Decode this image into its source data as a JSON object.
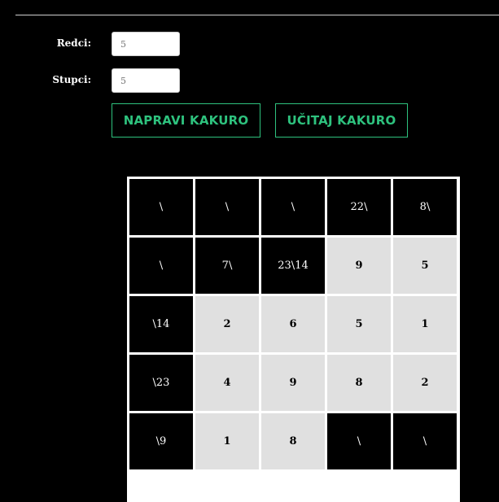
{
  "form": {
    "rows_label": "Redci:",
    "rows_value": "5",
    "cols_label": "Stupci:",
    "cols_value": "5"
  },
  "buttons": {
    "create": "NAPRAVI KAKURO",
    "load": "UČITAJ KAKURO"
  },
  "grid": {
    "rows": [
      [
        {
          "type": "black",
          "text": "\\"
        },
        {
          "type": "black",
          "text": "\\"
        },
        {
          "type": "black",
          "text": "\\"
        },
        {
          "type": "black",
          "text": "22\\"
        },
        {
          "type": "black",
          "text": "8\\"
        }
      ],
      [
        {
          "type": "black",
          "text": "\\"
        },
        {
          "type": "black",
          "text": "7\\"
        },
        {
          "type": "black",
          "text": "23\\14"
        },
        {
          "type": "white",
          "text": "9"
        },
        {
          "type": "white",
          "text": "5"
        }
      ],
      [
        {
          "type": "black",
          "text": "\\14"
        },
        {
          "type": "white",
          "text": "2"
        },
        {
          "type": "white",
          "text": "6"
        },
        {
          "type": "white",
          "text": "5"
        },
        {
          "type": "white",
          "text": "1"
        }
      ],
      [
        {
          "type": "black",
          "text": "\\23"
        },
        {
          "type": "white",
          "text": "4"
        },
        {
          "type": "white",
          "text": "9"
        },
        {
          "type": "white",
          "text": "8"
        },
        {
          "type": "white",
          "text": "2"
        }
      ],
      [
        {
          "type": "black",
          "text": "\\9"
        },
        {
          "type": "white",
          "text": "1"
        },
        {
          "type": "white",
          "text": "8"
        },
        {
          "type": "black",
          "text": "\\"
        },
        {
          "type": "black",
          "text": "\\"
        }
      ]
    ]
  }
}
